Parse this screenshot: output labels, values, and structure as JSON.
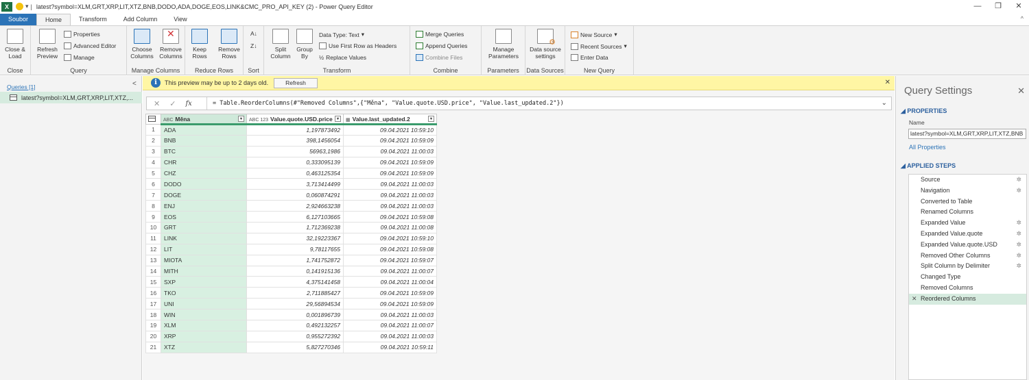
{
  "window": {
    "title": "latest?symbol=XLM,GRT,XRP,LIT,XTZ,BNB,DODO,ADA,DOGE,EOS,LINK&CMC_PRO_API_KEY (2) - Power Query Editor",
    "logo": "X"
  },
  "tabs": [
    "Soubor",
    "Home",
    "Transform",
    "Add Column",
    "View"
  ],
  "ribbon": {
    "close_load": "Close & Load",
    "refresh_preview": "Refresh Preview",
    "properties": "Properties",
    "advanced_editor": "Advanced Editor",
    "manage": "Manage",
    "choose_columns": "Choose Columns",
    "remove_columns": "Remove Columns",
    "keep_rows": "Keep Rows",
    "remove_rows": "Remove Rows",
    "split_column": "Split Column",
    "group_by": "Group By",
    "data_type": "Data Type: Text",
    "first_row_headers": "Use First Row as Headers",
    "replace_values": "Replace Values",
    "merge_queries": "Merge Queries",
    "append_queries": "Append Queries",
    "combine_files": "Combine Files",
    "manage_parameters": "Manage Parameters",
    "data_source_settings": "Data source settings",
    "new_source": "New Source",
    "recent_sources": "Recent Sources",
    "enter_data": "Enter Data",
    "groups": {
      "close": "Close",
      "query": "Query",
      "manage_columns": "Manage Columns",
      "reduce_rows": "Reduce Rows",
      "sort": "Sort",
      "transform": "Transform",
      "combine": "Combine",
      "parameters": "Parameters",
      "data_sources": "Data Sources",
      "new_query": "New Query"
    }
  },
  "queries": {
    "header": "Queries [1]",
    "item": "latest?symbol=XLM,GRT,XRP,LIT,XTZ,..."
  },
  "notice": {
    "text": "This preview may be up to 2 days old.",
    "button": "Refresh"
  },
  "formula": "= Table.ReorderColumns(#\"Removed Columns\",{\"Měna\", \"Value.quote.USD.price\", \"Value.last_updated.2\"})",
  "grid": {
    "columns": [
      {
        "type": "ABC",
        "name": "Měna"
      },
      {
        "type": "ABC 123",
        "name": "Value.quote.USD.price"
      },
      {
        "type": "",
        "name": "Value.last_updated.2"
      }
    ],
    "rows": [
      [
        "1",
        "ADA",
        "1,197873492",
        "09.04.2021 10:59:10"
      ],
      [
        "2",
        "BNB",
        "398,1456054",
        "09.04.2021 10:59:09"
      ],
      [
        "3",
        "BTC",
        "56963,1986",
        "09.04.2021 11:00:03"
      ],
      [
        "4",
        "CHR",
        "0,333095139",
        "09.04.2021 10:59:09"
      ],
      [
        "5",
        "CHZ",
        "0,463125354",
        "09.04.2021 10:59:09"
      ],
      [
        "6",
        "DODO",
        "3,713414499",
        "09.04.2021 11:00:03"
      ],
      [
        "7",
        "DOGE",
        "0,060874291",
        "09.04.2021 11:00:03"
      ],
      [
        "8",
        "ENJ",
        "2,924663238",
        "09.04.2021 11:00:03"
      ],
      [
        "9",
        "EOS",
        "6,127103665",
        "09.04.2021 10:59:08"
      ],
      [
        "10",
        "GRT",
        "1,712369238",
        "09.04.2021 11:00:08"
      ],
      [
        "11",
        "LINK",
        "32,19223367",
        "09.04.2021 10:59:10"
      ],
      [
        "12",
        "LIT",
        "9,78117655",
        "09.04.2021 10:59:08"
      ],
      [
        "13",
        "MIOTA",
        "1,741752872",
        "09.04.2021 10:59:07"
      ],
      [
        "14",
        "MITH",
        "0,141915136",
        "09.04.2021 11:00:07"
      ],
      [
        "15",
        "SXP",
        "4,375141458",
        "09.04.2021 11:00:04"
      ],
      [
        "16",
        "TKO",
        "2,711885427",
        "09.04.2021 10:59:09"
      ],
      [
        "17",
        "UNI",
        "29,56894534",
        "09.04.2021 10:59:09"
      ],
      [
        "18",
        "WIN",
        "0,001896739",
        "09.04.2021 11:00:03"
      ],
      [
        "19",
        "XLM",
        "0,492132257",
        "09.04.2021 11:00:07"
      ],
      [
        "20",
        "XRP",
        "0,955272392",
        "09.04.2021 11:00:03"
      ],
      [
        "21",
        "XTZ",
        "5,827270346",
        "09.04.2021 10:59:11"
      ]
    ]
  },
  "settings": {
    "title": "Query Settings",
    "properties_header": "PROPERTIES",
    "name_label": "Name",
    "name_value": "latest?symbol=XLM,GRT,XRP,LIT,XTZ,BNB",
    "all_properties": "All Properties",
    "applied_steps_header": "APPLIED STEPS",
    "steps": [
      {
        "label": "Source",
        "gear": true
      },
      {
        "label": "Navigation",
        "gear": true
      },
      {
        "label": "Converted to Table",
        "gear": false
      },
      {
        "label": "Renamed Columns",
        "gear": false
      },
      {
        "label": "Expanded Value",
        "gear": true
      },
      {
        "label": "Expanded Value.quote",
        "gear": true
      },
      {
        "label": "Expanded Value.quote.USD",
        "gear": true
      },
      {
        "label": "Removed Other Columns",
        "gear": true
      },
      {
        "label": "Split Column by Delimiter",
        "gear": true
      },
      {
        "label": "Changed Type",
        "gear": false
      },
      {
        "label": "Removed Columns",
        "gear": false
      },
      {
        "label": "Reordered Columns",
        "gear": false,
        "active": true
      }
    ]
  },
  "colors": {
    "accent": "#2b73b7",
    "selected_column": "#d8f0e1",
    "notice_bg": "#fff6a4",
    "excel_green": "#1e7145"
  }
}
